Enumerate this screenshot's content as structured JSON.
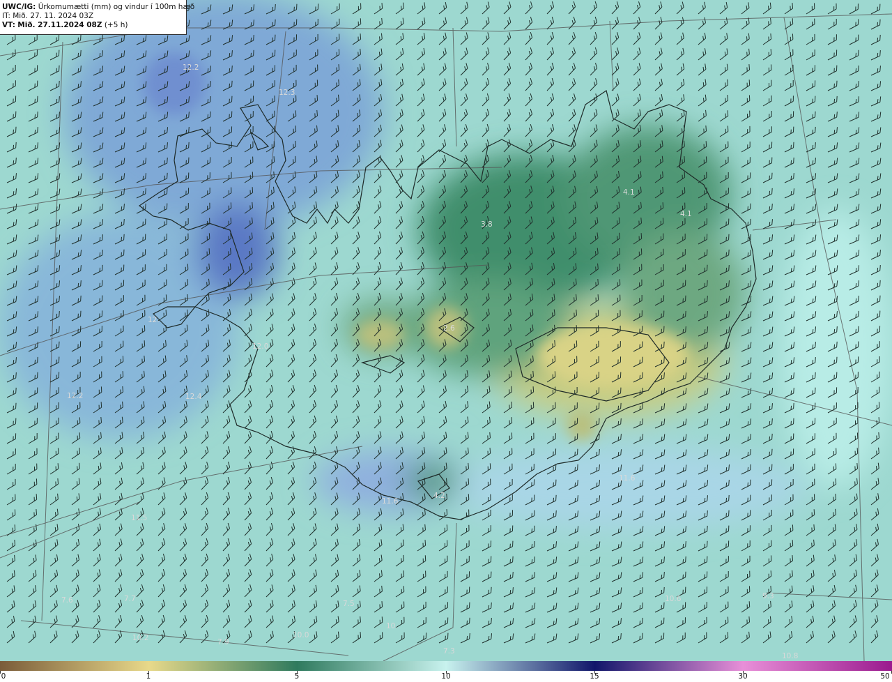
{
  "header": {
    "product": "UWC/IG:",
    "title": "Úrkomumætti (mm) og vindur í 100m hæð",
    "it_prefix": "IT:",
    "it_value": "Mið. 27. 11. 2024 03Z",
    "vt_prefix": "VT:",
    "vt_value": "Mið. 27.11.2024 08Z",
    "vt_offset": "(+5 h)"
  },
  "colorbar": {
    "ticks": [
      "0",
      "1",
      "5",
      "10",
      "15",
      "30",
      "50"
    ],
    "stops": [
      {
        "value": 0,
        "color": "#7a5c3a"
      },
      {
        "value": 1,
        "color": "#e8d98a"
      },
      {
        "value": 5,
        "color": "#2f7a5e"
      },
      {
        "value": 10,
        "color": "#c8f2ee"
      },
      {
        "value": 15,
        "color": "#11166a"
      },
      {
        "value": 30,
        "color": "#e88fd8"
      },
      {
        "value": 50,
        "color": "#9a1a8e"
      }
    ]
  },
  "map_labels": [
    "12.2",
    "12.3",
    "4.1",
    "4.1",
    "3.8",
    "12.",
    "2.6",
    "12.0",
    "12.2",
    "12.4",
    "11.6",
    "4.2",
    "11.5",
    "7.6",
    "7.7",
    "7.5",
    "10.2",
    "7.9",
    "10.0",
    "10.",
    "7.3",
    "10.8",
    "9.3",
    "11.6",
    "10.6"
  ]
}
